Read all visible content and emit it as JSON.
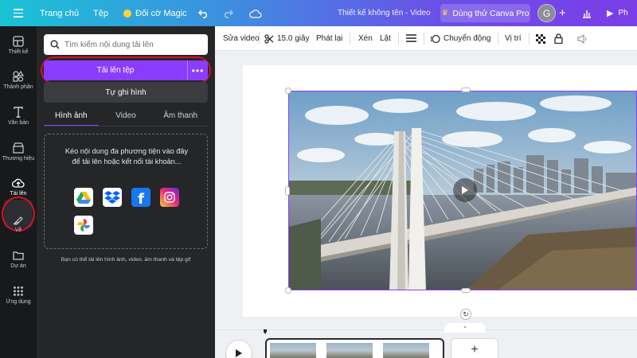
{
  "topbar": {
    "home": "Trang chủ",
    "file": "Tệp",
    "magic": "Đối cờ Magic",
    "title": "Thiết kế không tên - Video",
    "pro": "Dùng thử Canva Pro",
    "avatar": "G",
    "colors": {
      "gradient_start": "#19c3d6",
      "gradient_end": "#7a3de6"
    }
  },
  "rail": {
    "items": [
      {
        "label": "Thiết kế",
        "icon": "layout-icon"
      },
      {
        "label": "Thành phần",
        "icon": "shapes-icon"
      },
      {
        "label": "Văn bản",
        "icon": "text-icon"
      },
      {
        "label": "Thương hiệu",
        "icon": "brand-icon"
      },
      {
        "label": "Tải lên",
        "icon": "cloud-upload-icon"
      },
      {
        "label": "Vẽ",
        "icon": "pen-icon"
      },
      {
        "label": "Dự án",
        "icon": "folder-icon"
      },
      {
        "label": "Ứng dụng",
        "icon": "apps-grid-icon"
      }
    ]
  },
  "panel": {
    "search_placeholder": "Tìm kiếm nội dung tải lên",
    "upload_label": "Tải lên tệp",
    "more": "•••",
    "record_label": "Tự ghi hình",
    "tabs": [
      "Hình ảnh",
      "Video",
      "Âm thanh"
    ],
    "drop_text": "Kéo nội dung đa phương tiện vào đây để tải lên hoặc kết nối tài khoản...",
    "hint": "Bạn có thể tải lên hình ảnh, video, âm thanh và tệp gif",
    "services": [
      "google-drive-icon",
      "dropbox-icon",
      "facebook-icon",
      "instagram-icon",
      "google-photos-icon"
    ]
  },
  "toolbar": {
    "edit_video": "Sửa video",
    "duration": "15.0 giây",
    "playback": "Phát lại",
    "delete": "Xén",
    "flip": "Lật",
    "animate": "Chuyển động",
    "position": "Vị trí"
  },
  "timeline": {
    "add": "+"
  },
  "accent_color": "#8b3dff",
  "highlight_color": "#d4112b"
}
